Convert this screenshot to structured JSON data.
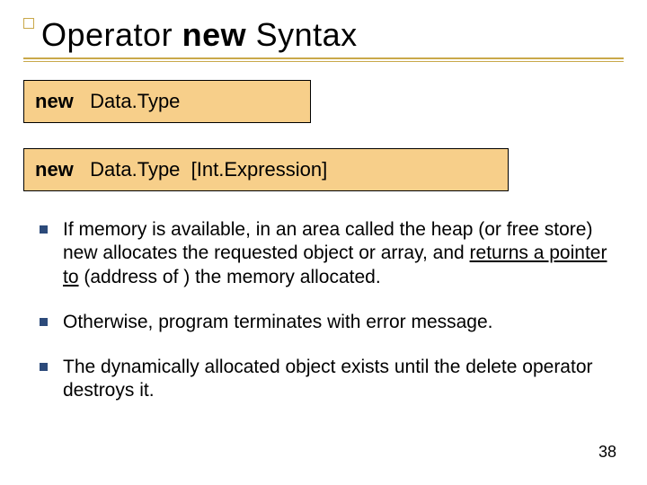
{
  "title": {
    "pre": "Operator ",
    "bold": "new",
    "post": " Syntax"
  },
  "syntax": {
    "box1": {
      "kw": "new",
      "rest": "   Data.Type"
    },
    "box2": {
      "kw": "new",
      "rest": "   Data.Type  [Int.Expression]"
    }
  },
  "bullets": {
    "b1_pre": "If memory is available, in an area called the heap (or free store) new allocates the requested object or array, and ",
    "b1_ul": "returns a pointer to",
    "b1_post": " (address of ) the memory allocated.",
    "b2": "Otherwise, program terminates with error message.",
    "b3": "The dynamically allocated object exists until the delete operator destroys it."
  },
  "page_number": "38"
}
